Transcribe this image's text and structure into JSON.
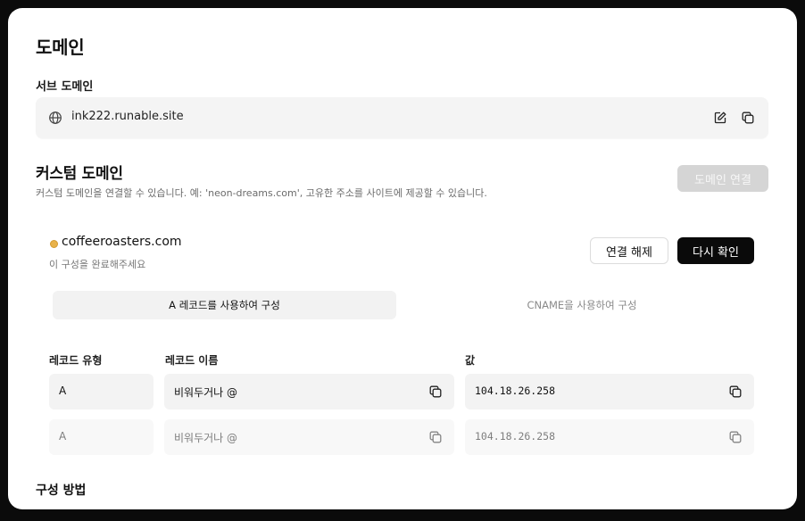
{
  "page": {
    "title": "도메인"
  },
  "subdomain": {
    "label": "서브 도메인",
    "value": "ink222.runable.site",
    "icons": [
      "globe-icon",
      "edit-icon",
      "copy-icon"
    ]
  },
  "custom": {
    "title": "커스텀 도메인",
    "description": "커스텀 도메인을 연결할 수 있습니다. 예: 'neon-dreams.com', 고유한 주소를 사이트에 제공할 수 있습니다.",
    "connect_button": "도메인 연결"
  },
  "domain": {
    "name": "coffeeroasters.com",
    "status": "이 구성을 완료해주세요",
    "status_color": "#e8b24a",
    "disconnect_button": "연결 해제",
    "recheck_button": "다시 확인",
    "tabs": [
      {
        "label": "A 레코드를 사용하여 구성",
        "active": true
      },
      {
        "label": "CNAME을 사용하여 구성",
        "active": false
      }
    ],
    "columns": [
      "레코드 유형",
      "레코드 이름",
      "값"
    ],
    "rows": [
      {
        "type": "A",
        "name": "비워두거나 @",
        "value": "104.18.26.258"
      },
      {
        "type": "A",
        "name": "비워두거나 @",
        "value": "104.18.26.258"
      }
    ]
  },
  "setup": {
    "title": "구성 방법"
  }
}
